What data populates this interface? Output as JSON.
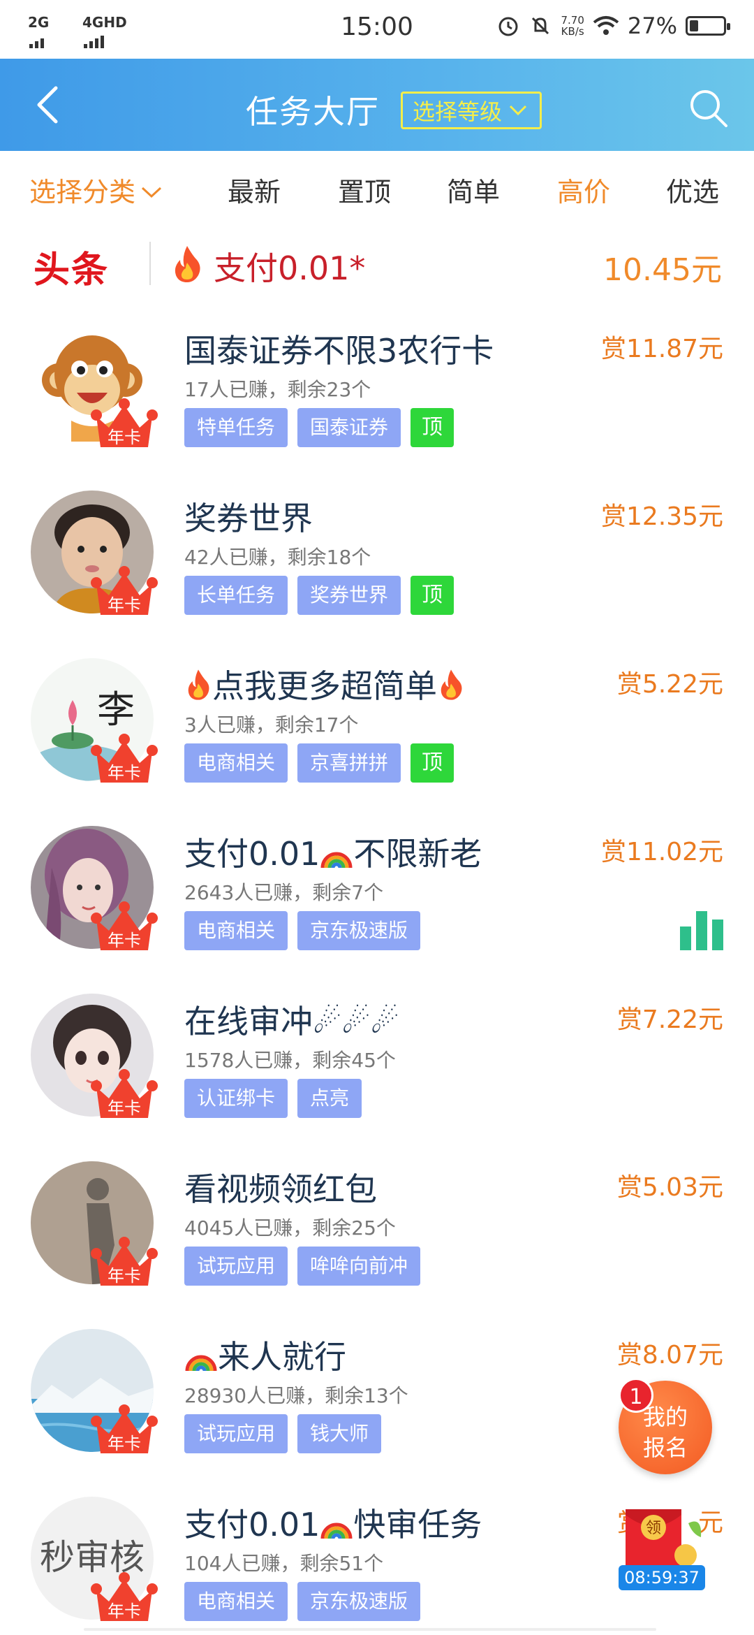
{
  "status_bar": {
    "sim1": "2G",
    "sim2": "4GHD",
    "time": "15:00",
    "net_speed_value": "7.70",
    "net_speed_unit": "KB/s",
    "battery_percent": "27%",
    "battery_level": 0.27
  },
  "header": {
    "title": "任务大厅",
    "level_button": "选择等级"
  },
  "categories": {
    "select": "选择分类",
    "items": [
      "最新",
      "置顶",
      "简单",
      "高价",
      "优选"
    ],
    "active": "高价"
  },
  "headline": {
    "logo": "头条",
    "text": "支付0.01*",
    "amount": "10.45元"
  },
  "tasks": [
    {
      "title": "国泰证券不限3农行卡",
      "stats": "17人已赚，剩余23个",
      "reward": "赏11.87元",
      "tags": [
        "特单任务",
        "国泰证券"
      ],
      "top": "顶",
      "badge": "年卡"
    },
    {
      "title": "奖券世界",
      "stats": "42人已赚，剩余18个",
      "reward": "赏12.35元",
      "tags": [
        "长单任务",
        "奖券世界"
      ],
      "top": "顶",
      "badge": "年卡"
    },
    {
      "title": "点我更多超简单",
      "stats": "3人已赚，剩余17个",
      "reward": "赏5.22元",
      "tags": [
        "电商相关",
        "京喜拼拼"
      ],
      "top": "顶",
      "badge": "年卡",
      "avatar_text": "李"
    },
    {
      "title_a": "支付0.01",
      "title_b": "不限新老",
      "stats": "2643人已赚，剩余7个",
      "reward": "赏11.02元",
      "tags": [
        "电商相关",
        "京东极速版"
      ],
      "badge": "年卡"
    },
    {
      "title": "在线审冲☄☄☄",
      "stats": "1578人已赚，剩余45个",
      "reward": "赏7.22元",
      "tags": [
        "认证绑卡",
        "点亮"
      ],
      "badge": "年卡"
    },
    {
      "title": "看视频领红包",
      "stats": "4045人已赚，剩余25个",
      "reward": "赏5.03元",
      "tags": [
        "试玩应用",
        "哞哞向前冲"
      ],
      "badge": "年卡"
    },
    {
      "title": "来人就行",
      "stats": "28930人已赚，剩余13个",
      "reward": "赏8.07元",
      "tags": [
        "试玩应用",
        "钱大师"
      ],
      "badge": "年卡"
    },
    {
      "title_a": "支付0.01",
      "title_b": "快审任务",
      "stats": "104人已赚，剩余51个",
      "reward": "赏",
      "reward_tail": "元",
      "tags": [
        "电商相关",
        "京东极速版"
      ],
      "badge": "年卡",
      "avatar_text": "秒审核"
    }
  ],
  "floating": {
    "signup_line1": "我的",
    "signup_line2": "报名",
    "signup_count": "1",
    "redpack_label": "领",
    "countdown": "08:59:37"
  },
  "colors": {
    "header_start": "#3f9ae8",
    "header_end": "#6bc6ea",
    "accent_orange": "#f08a2a",
    "tag_blue": "#8ea6f5",
    "tag_green": "#2ed73a",
    "headline_red": "#e0161d"
  },
  "icons": [
    "back-icon",
    "search-icon",
    "chevron-down-icon",
    "fire-icon",
    "rainbow-icon",
    "crown-icon",
    "bar-chart-icon",
    "red-packet-icon"
  ]
}
